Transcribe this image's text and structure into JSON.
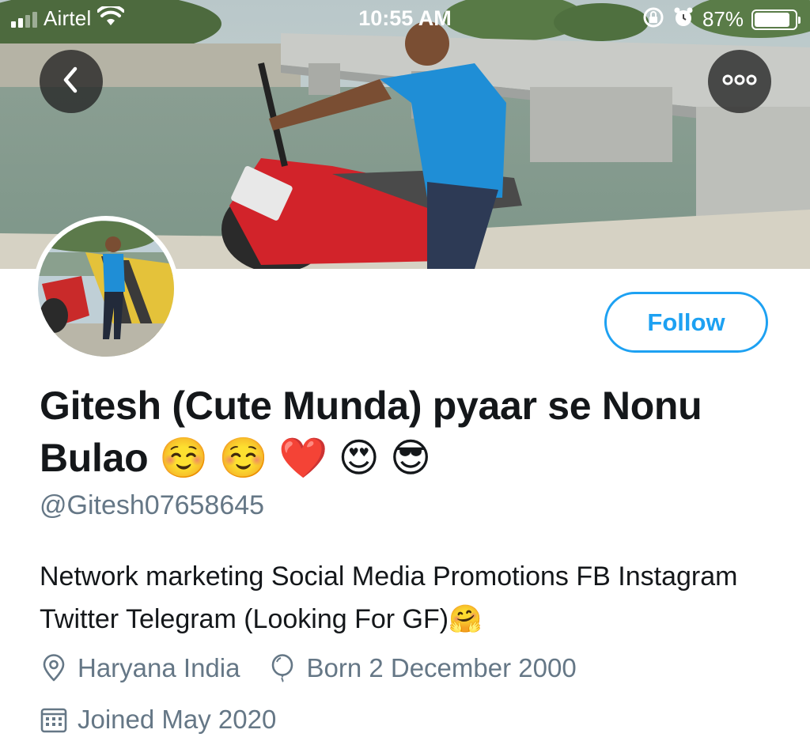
{
  "status_bar": {
    "carrier": "Airtel",
    "time": "10:55 AM",
    "battery_percent": "87%",
    "battery_level": 0.87,
    "icons": [
      "signal-icon",
      "wifi-icon",
      "orientation-lock-icon",
      "alarm-icon",
      "battery-icon"
    ]
  },
  "header": {
    "back_icon": "chevron-left-icon",
    "more_icon": "more-horizontal-icon"
  },
  "profile": {
    "follow_label": "Follow",
    "display_name": "Gitesh (Cute Munda) pyaar se Nonu Bulao ☺️ ☺️ ❤️ 😍 😎",
    "handle": "@Gitesh07658645",
    "bio": "Network marketing Social Media Promotions FB Instagram Twitter Telegram (Looking For GF)🤗",
    "location": "Haryana India",
    "birthday": "Born 2 December 2000",
    "joined": "Joined May 2020"
  },
  "colors": {
    "accent": "#1da1f2",
    "secondary_text": "#657786",
    "primary_text": "#14171a"
  }
}
